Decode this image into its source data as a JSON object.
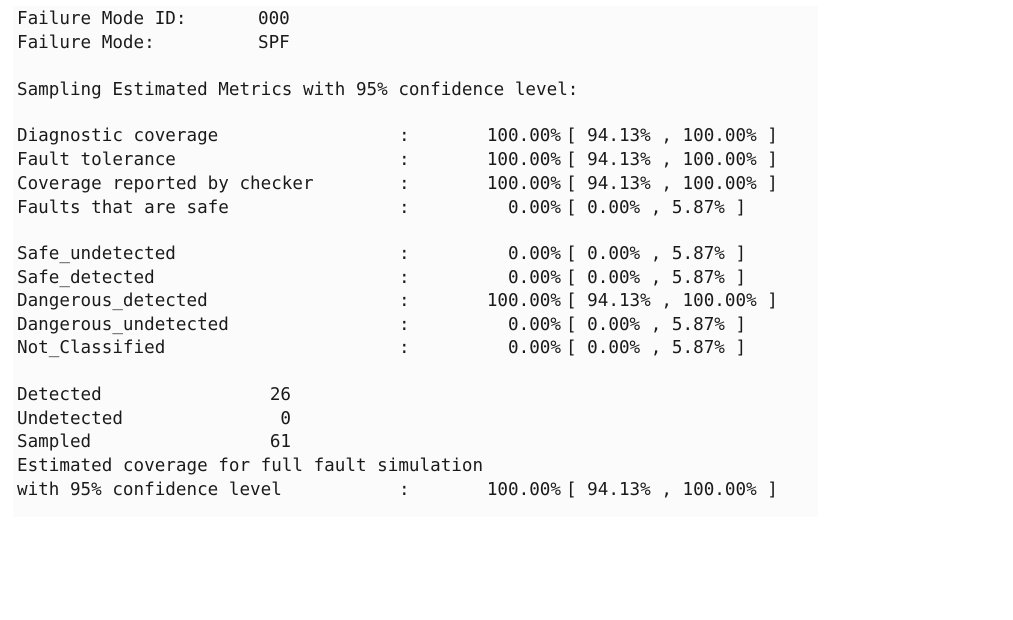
{
  "header": {
    "id_label": "Failure Mode ID:",
    "id_value": "000",
    "mode_label": "Failure Mode:",
    "mode_value": "SPF"
  },
  "section_title": "Sampling Estimated Metrics with 95% confidence level:",
  "metrics_group1": [
    {
      "label": "Diagnostic coverage",
      "colon": ":",
      "value": "100.00%",
      "ci": "[ 94.13% , 100.00% ]"
    },
    {
      "label": "Fault tolerance",
      "colon": ":",
      "value": "100.00%",
      "ci": "[ 94.13% , 100.00% ]"
    },
    {
      "label": "Coverage reported by checker",
      "colon": ":",
      "value": "100.00%",
      "ci": "[ 94.13% , 100.00% ]"
    },
    {
      "label": "Faults that are safe",
      "colon": ":",
      "value": "0.00%",
      "ci": "[ 0.00% , 5.87% ]"
    }
  ],
  "metrics_group2": [
    {
      "label": "Safe_undetected",
      "colon": ":",
      "value": "0.00%",
      "ci": "[ 0.00% , 5.87% ]"
    },
    {
      "label": "Safe_detected",
      "colon": ":",
      "value": "0.00%",
      "ci": "[ 0.00% , 5.87% ]"
    },
    {
      "label": "Dangerous_detected",
      "colon": ":",
      "value": "100.00%",
      "ci": "[ 94.13% , 100.00% ]"
    },
    {
      "label": "Dangerous_undetected",
      "colon": ":",
      "value": "0.00%",
      "ci": "[ 0.00% , 5.87% ]"
    },
    {
      "label": "Not_Classified",
      "colon": ":",
      "value": "0.00%",
      "ci": "[ 0.00% , 5.87% ]"
    }
  ],
  "counts": [
    {
      "label": "Detected",
      "value": "26"
    },
    {
      "label": "Undetected",
      "value": "0"
    },
    {
      "label": "Sampled",
      "value": "61"
    }
  ],
  "estimate": {
    "line1": "Estimated coverage for full fault simulation",
    "label": "with 95% confidence level",
    "colon": ":",
    "value": "100.00%",
    "ci": "[ 94.13% , 100.00% ]"
  }
}
